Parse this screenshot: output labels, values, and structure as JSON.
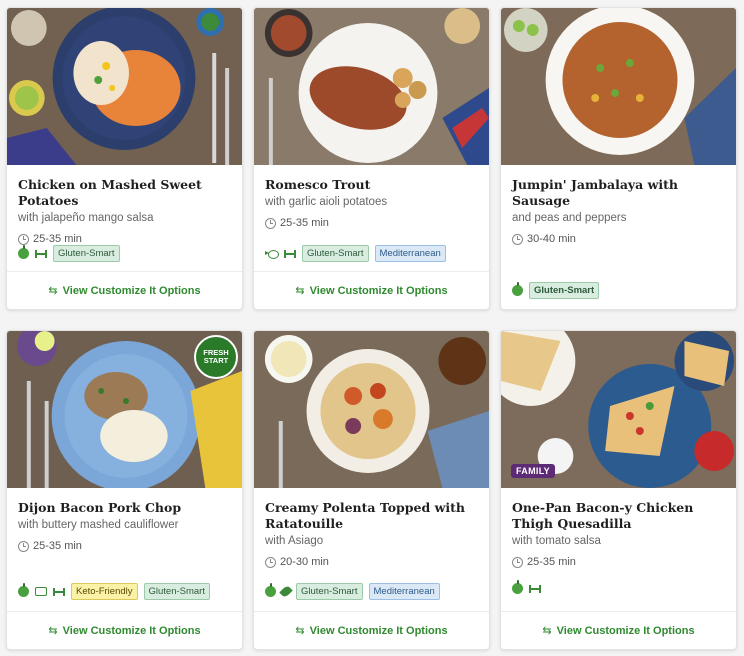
{
  "cards": [
    {
      "title": "Chicken on Mashed Sweet Potatoes",
      "subtitle": "with jalapeño mango salsa",
      "time": "25-35 min",
      "icons": [
        "apple-icon",
        "dumbbell-icon"
      ],
      "tags": [
        {
          "label": "Gluten-Smart",
          "color": "green"
        }
      ],
      "footer": "View Customize It Options"
    },
    {
      "title": "Romesco Trout",
      "subtitle": "with garlic aioli potatoes",
      "time": "25-35 min",
      "icons": [
        "fish-icon",
        "dumbbell-icon"
      ],
      "tags": [
        {
          "label": "Gluten-Smart",
          "color": "green"
        },
        {
          "label": "Mediterranean",
          "color": "blue"
        }
      ],
      "footer": "View Customize It Options"
    },
    {
      "title": "Jumpin' Jambalaya with Sausage",
      "subtitle": "and peas and peppers",
      "time": "30-40 min",
      "icons": [
        "apple-icon"
      ],
      "tags": [
        {
          "label": "Gluten-Smart",
          "color": "green"
        }
      ],
      "footer": "View Customize It Options"
    },
    {
      "title": "Dijon Bacon Pork Chop",
      "subtitle": "with buttery mashed cauliflower",
      "time": "25-35 min",
      "icons": [
        "apple-icon",
        "box-icon",
        "dumbbell-icon"
      ],
      "tags": [
        {
          "label": "Keto-Friendly",
          "color": "yellow"
        },
        {
          "label": "Gluten-Smart",
          "color": "green"
        }
      ],
      "badge_fresh": "FRESH START",
      "footer": "View Customize It Options"
    },
    {
      "title": "Creamy Polenta Topped with Ratatouille",
      "subtitle": "with Asiago",
      "time": "20-30 min",
      "icons": [
        "apple-icon",
        "leaf-icon"
      ],
      "tags": [
        {
          "label": "Gluten-Smart",
          "color": "green"
        },
        {
          "label": "Mediterranean",
          "color": "blue"
        }
      ],
      "footer": "View Customize It Options"
    },
    {
      "title": "One-Pan Bacon-y Chicken Thigh Quesadilla",
      "subtitle": "with tomato salsa",
      "time": "25-35 min",
      "icons": [
        "apple-icon",
        "dumbbell-icon"
      ],
      "tags": [],
      "badge_family": "FAMILY",
      "footer": "View Customize It Options"
    }
  ],
  "colors": {
    "accent": "#2f8a2f",
    "tag_green": "#d8ede0",
    "tag_blue": "#dbe9f7",
    "tag_yellow": "#fbf1a7",
    "family_badge": "#5d2a76"
  }
}
